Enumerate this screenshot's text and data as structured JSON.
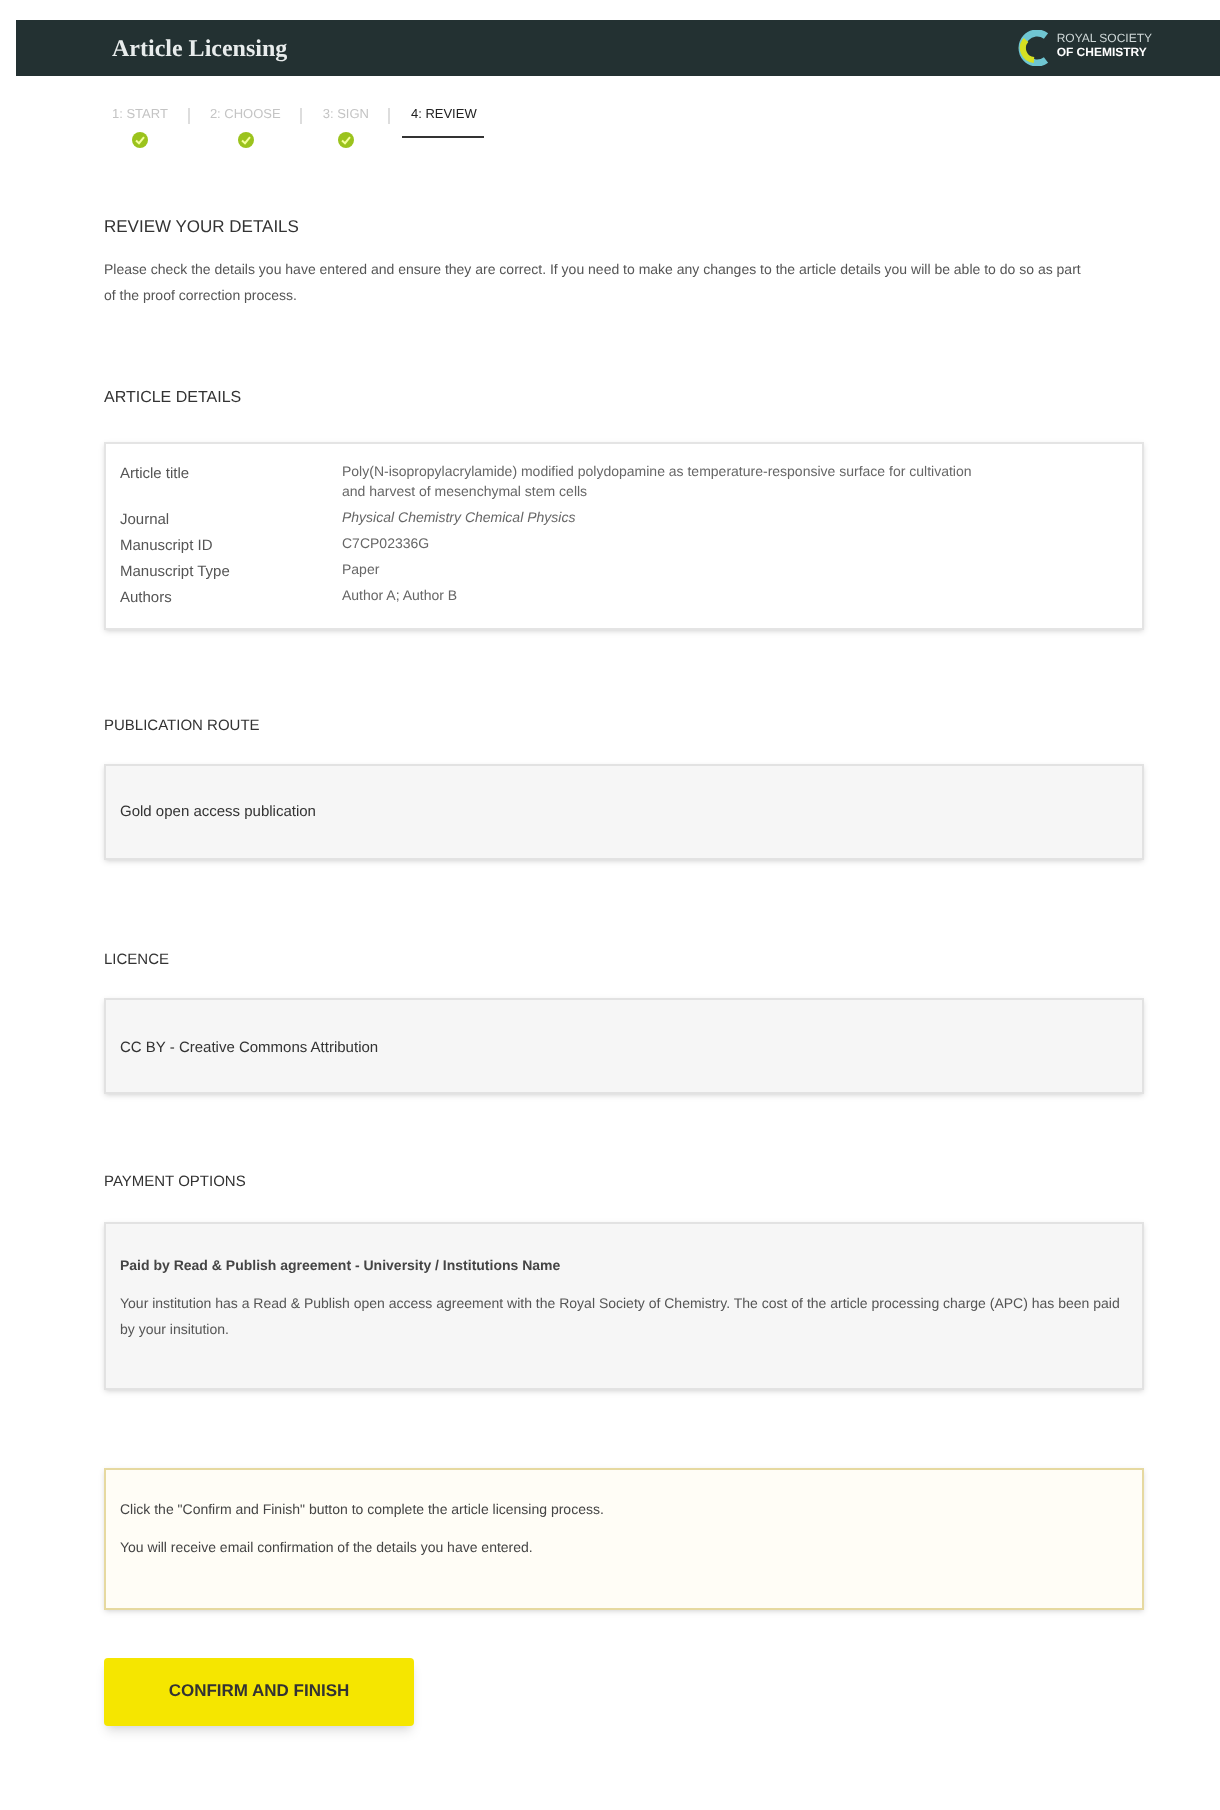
{
  "header": {
    "title": "Article Licensing",
    "logo_line_1": "ROYAL SOCIETY",
    "logo_line_2": "OF CHEMISTRY"
  },
  "steps": [
    {
      "label": "1: START",
      "done": true,
      "selected": false
    },
    {
      "label": "2: CHOOSE",
      "done": true,
      "selected": false
    },
    {
      "label": "3: SIGN",
      "done": true,
      "selected": false
    },
    {
      "label": "4: REVIEW",
      "done": false,
      "selected": true
    }
  ],
  "review": {
    "heading": "REVIEW YOUR DETAILS",
    "text": "Please check the details you have entered and ensure they are correct. If you need to make any changes to the article details you will be able to do so as part of the proof correction process."
  },
  "article_details": {
    "heading": "ARTICLE DETAILS",
    "rows": [
      {
        "label": "Article title",
        "value": "Poly(N-isopropylacrylamide) modified polydopamine as temperature-responsive surface for cultivation and harvest of mesenchymal stem cells",
        "italic": false
      },
      {
        "label": "Journal",
        "value": "Physical Chemistry Chemical Physics",
        "italic": true
      },
      {
        "label": "Manuscript ID",
        "value": "C7CP02336G",
        "italic": false
      },
      {
        "label": "Manuscript Type",
        "value": "Paper",
        "italic": false
      },
      {
        "label": "Authors",
        "value": "Author A; Author B",
        "italic": false
      }
    ]
  },
  "publication_route": {
    "heading": "PUBLICATION ROUTE",
    "value": "Gold open access publication"
  },
  "licence": {
    "heading": "LICENCE",
    "value": "CC BY - Creative Commons Attribution"
  },
  "payment_options": {
    "heading": "PAYMENT OPTIONS",
    "title": "Paid by Read & Publish agreement - University / Institutions Name",
    "text": "Your institution has a Read & Publish open access agreement with the Royal Society of Chemistry. The cost of the article processing charge (APC) has been paid by your insitution."
  },
  "notice": [
    "Click the \"Confirm and Finish\" button to complete the article licensing process.",
    "You will receive email confirmation of the details you have entered."
  ],
  "confirm_button": "CONFIRM AND FINISH"
}
